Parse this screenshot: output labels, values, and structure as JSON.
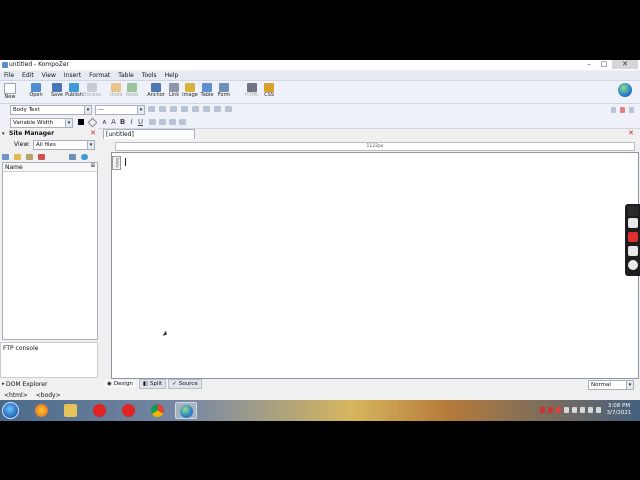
{
  "window": {
    "title": "untitled - KompoZer",
    "minimize": "–",
    "maximize": "□",
    "close": "✕"
  },
  "menu": [
    "File",
    "Edit",
    "View",
    "Insert",
    "Format",
    "Table",
    "Tools",
    "Help"
  ],
  "toolbar": [
    {
      "label": "New",
      "icon": "new-page-icon",
      "color": "#ffffff",
      "disabled": false
    },
    {
      "label": "Open",
      "icon": "open-folder-icon",
      "color": "#4f8cd0",
      "disabled": false
    },
    {
      "label": "Save",
      "icon": "save-disk-icon",
      "color": "#4a74b5",
      "disabled": false
    },
    {
      "label": "Publish",
      "icon": "publish-globe-icon",
      "color": "#3f9bd8",
      "disabled": false
    },
    {
      "label": "Browse",
      "icon": "browse-icon",
      "color": "#c7ccd4",
      "disabled": true
    },
    {
      "label": "Undo",
      "icon": "undo-arrow-icon",
      "color": "#e8c48c",
      "disabled": true
    },
    {
      "label": "Redo",
      "icon": "redo-arrow-icon",
      "color": "#9cc49a",
      "disabled": true
    },
    {
      "label": "Anchor",
      "icon": "anchor-icon",
      "color": "#4b78b0",
      "disabled": false
    },
    {
      "label": "Link",
      "icon": "link-chain-icon",
      "color": "#8c96a8",
      "disabled": false
    },
    {
      "label": "Image",
      "icon": "image-icon",
      "color": "#d8b040",
      "disabled": false
    },
    {
      "label": "Table",
      "icon": "table-grid-icon",
      "color": "#5e8fcf",
      "disabled": false
    },
    {
      "label": "Form",
      "icon": "form-icon",
      "color": "#6f8fb8",
      "disabled": false
    },
    {
      "label": "HTML",
      "icon": "html-pen-icon",
      "color": "#6f7480",
      "disabled": true
    },
    {
      "label": "CSS",
      "icon": "css-icon",
      "color": "#d6a02a",
      "disabled": false
    }
  ],
  "format": {
    "paragraph_style": "Body Text",
    "class_select": "---",
    "font": "Variable Width",
    "bold": "B",
    "italic": "I",
    "underline": "U"
  },
  "site_manager": {
    "title": "Site Manager",
    "close": "✕",
    "view_label": "View:",
    "view_value": "All files",
    "column_name": "Name"
  },
  "ftp_console": "FTP console",
  "dom_explorer": "DOM Explorer",
  "breadcrumb": [
    "<html>",
    "<body>"
  ],
  "editor": {
    "tab_label": "[untitled]",
    "ruler_label": "1122px",
    "body_tag": "body",
    "modes": [
      "Design",
      "Split",
      "Source"
    ],
    "zoom": "Normal"
  },
  "clock": {
    "time": "3:08 PM",
    "date": "3/7/2021"
  },
  "colors": {
    "accent": "#2a7dc8",
    "close_red": "#cc2222"
  }
}
